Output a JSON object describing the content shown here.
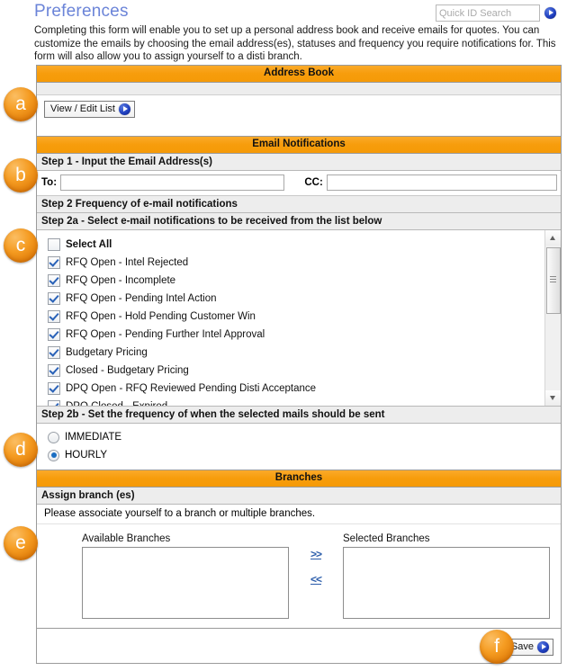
{
  "header": {
    "title": "Preferences",
    "search_placeholder": "Quick ID Search",
    "go_icon": "blue-arrow-go-icon",
    "intro": "Completing this form will enable you to set up a personal address book and receive emails for quotes. You can customize the emails by choosing the email address(es), statuses and frequency you require notifications for. This form will also allow you to assign yourself to a disti branch."
  },
  "address_book": {
    "section_title": "Address Book",
    "view_edit_label": "View / Edit List"
  },
  "email_notifications": {
    "section_title": "Email Notifications",
    "step1_title": "Step 1 - Input the Email Address(s)",
    "to_label": "To:",
    "to_value": "",
    "cc_label": "CC:",
    "cc_value": "",
    "step2_title": "Step 2 Frequency of e-mail notifications",
    "step2a_title": "Step 2a - Select e-mail notifications to be received from the list below",
    "select_all_label": "Select All",
    "select_all_checked": false,
    "items": [
      {
        "label": "RFQ Open - Intel Rejected",
        "checked": true
      },
      {
        "label": "RFQ Open - Incomplete",
        "checked": true
      },
      {
        "label": "RFQ Open - Pending Intel Action",
        "checked": true
      },
      {
        "label": "RFQ Open - Hold Pending Customer Win",
        "checked": true
      },
      {
        "label": "RFQ Open - Pending Further Intel Approval",
        "checked": true
      },
      {
        "label": "Budgetary Pricing",
        "checked": true
      },
      {
        "label": "Closed - Budgetary Pricing",
        "checked": true
      },
      {
        "label": "DPQ Open - RFQ Reviewed Pending Disti Acceptance",
        "checked": true
      },
      {
        "label": "DPQ Closed - Expired",
        "checked": true
      }
    ],
    "step2b_title": "Step 2b - Set the frequency of when the selected mails should be sent",
    "frequency_options": [
      {
        "label": "IMMEDIATE",
        "selected": false
      },
      {
        "label": "HOURLY",
        "selected": true
      }
    ]
  },
  "branches": {
    "section_title": "Branches",
    "assign_title": "Assign branch (es)",
    "note": "Please associate yourself to a branch or multiple branches.",
    "available_label": "Available Branches",
    "selected_label": "Selected Branches",
    "available_items": [],
    "selected_items": [],
    "move_right_label": ">>",
    "move_left_label": "<<"
  },
  "footer": {
    "save_label": "Save"
  },
  "annotations": [
    {
      "id": "a",
      "label": "a"
    },
    {
      "id": "b",
      "label": "b"
    },
    {
      "id": "c",
      "label": "c"
    },
    {
      "id": "d",
      "label": "d"
    },
    {
      "id": "e",
      "label": "e"
    },
    {
      "id": "f",
      "label": "f"
    }
  ],
  "colors": {
    "section_bar": "#f79d0c",
    "title": "#6b84d8",
    "badge": "#f59c22",
    "link": "#2a5caa"
  }
}
